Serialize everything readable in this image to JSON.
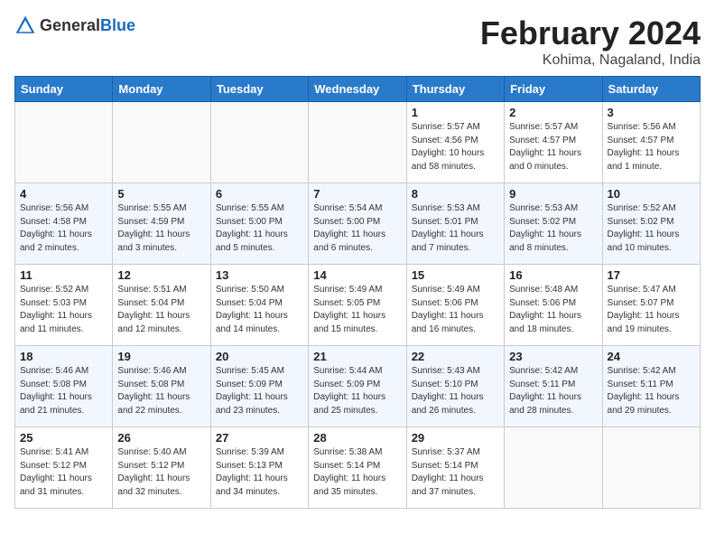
{
  "header": {
    "logo_general": "General",
    "logo_blue": "Blue",
    "month_title": "February 2024",
    "location": "Kohima, Nagaland, India"
  },
  "weekdays": [
    "Sunday",
    "Monday",
    "Tuesday",
    "Wednesday",
    "Thursday",
    "Friday",
    "Saturday"
  ],
  "weeks": [
    [
      {
        "day": "",
        "info": ""
      },
      {
        "day": "",
        "info": ""
      },
      {
        "day": "",
        "info": ""
      },
      {
        "day": "",
        "info": ""
      },
      {
        "day": "1",
        "info": "Sunrise: 5:57 AM\nSunset: 4:56 PM\nDaylight: 10 hours\nand 58 minutes."
      },
      {
        "day": "2",
        "info": "Sunrise: 5:57 AM\nSunset: 4:57 PM\nDaylight: 11 hours\nand 0 minutes."
      },
      {
        "day": "3",
        "info": "Sunrise: 5:56 AM\nSunset: 4:57 PM\nDaylight: 11 hours\nand 1 minute."
      }
    ],
    [
      {
        "day": "4",
        "info": "Sunrise: 5:56 AM\nSunset: 4:58 PM\nDaylight: 11 hours\nand 2 minutes."
      },
      {
        "day": "5",
        "info": "Sunrise: 5:55 AM\nSunset: 4:59 PM\nDaylight: 11 hours\nand 3 minutes."
      },
      {
        "day": "6",
        "info": "Sunrise: 5:55 AM\nSunset: 5:00 PM\nDaylight: 11 hours\nand 5 minutes."
      },
      {
        "day": "7",
        "info": "Sunrise: 5:54 AM\nSunset: 5:00 PM\nDaylight: 11 hours\nand 6 minutes."
      },
      {
        "day": "8",
        "info": "Sunrise: 5:53 AM\nSunset: 5:01 PM\nDaylight: 11 hours\nand 7 minutes."
      },
      {
        "day": "9",
        "info": "Sunrise: 5:53 AM\nSunset: 5:02 PM\nDaylight: 11 hours\nand 8 minutes."
      },
      {
        "day": "10",
        "info": "Sunrise: 5:52 AM\nSunset: 5:02 PM\nDaylight: 11 hours\nand 10 minutes."
      }
    ],
    [
      {
        "day": "11",
        "info": "Sunrise: 5:52 AM\nSunset: 5:03 PM\nDaylight: 11 hours\nand 11 minutes."
      },
      {
        "day": "12",
        "info": "Sunrise: 5:51 AM\nSunset: 5:04 PM\nDaylight: 11 hours\nand 12 minutes."
      },
      {
        "day": "13",
        "info": "Sunrise: 5:50 AM\nSunset: 5:04 PM\nDaylight: 11 hours\nand 14 minutes."
      },
      {
        "day": "14",
        "info": "Sunrise: 5:49 AM\nSunset: 5:05 PM\nDaylight: 11 hours\nand 15 minutes."
      },
      {
        "day": "15",
        "info": "Sunrise: 5:49 AM\nSunset: 5:06 PM\nDaylight: 11 hours\nand 16 minutes."
      },
      {
        "day": "16",
        "info": "Sunrise: 5:48 AM\nSunset: 5:06 PM\nDaylight: 11 hours\nand 18 minutes."
      },
      {
        "day": "17",
        "info": "Sunrise: 5:47 AM\nSunset: 5:07 PM\nDaylight: 11 hours\nand 19 minutes."
      }
    ],
    [
      {
        "day": "18",
        "info": "Sunrise: 5:46 AM\nSunset: 5:08 PM\nDaylight: 11 hours\nand 21 minutes."
      },
      {
        "day": "19",
        "info": "Sunrise: 5:46 AM\nSunset: 5:08 PM\nDaylight: 11 hours\nand 22 minutes."
      },
      {
        "day": "20",
        "info": "Sunrise: 5:45 AM\nSunset: 5:09 PM\nDaylight: 11 hours\nand 23 minutes."
      },
      {
        "day": "21",
        "info": "Sunrise: 5:44 AM\nSunset: 5:09 PM\nDaylight: 11 hours\nand 25 minutes."
      },
      {
        "day": "22",
        "info": "Sunrise: 5:43 AM\nSunset: 5:10 PM\nDaylight: 11 hours\nand 26 minutes."
      },
      {
        "day": "23",
        "info": "Sunrise: 5:42 AM\nSunset: 5:11 PM\nDaylight: 11 hours\nand 28 minutes."
      },
      {
        "day": "24",
        "info": "Sunrise: 5:42 AM\nSunset: 5:11 PM\nDaylight: 11 hours\nand 29 minutes."
      }
    ],
    [
      {
        "day": "25",
        "info": "Sunrise: 5:41 AM\nSunset: 5:12 PM\nDaylight: 11 hours\nand 31 minutes."
      },
      {
        "day": "26",
        "info": "Sunrise: 5:40 AM\nSunset: 5:12 PM\nDaylight: 11 hours\nand 32 minutes."
      },
      {
        "day": "27",
        "info": "Sunrise: 5:39 AM\nSunset: 5:13 PM\nDaylight: 11 hours\nand 34 minutes."
      },
      {
        "day": "28",
        "info": "Sunrise: 5:38 AM\nSunset: 5:14 PM\nDaylight: 11 hours\nand 35 minutes."
      },
      {
        "day": "29",
        "info": "Sunrise: 5:37 AM\nSunset: 5:14 PM\nDaylight: 11 hours\nand 37 minutes."
      },
      {
        "day": "",
        "info": ""
      },
      {
        "day": "",
        "info": ""
      }
    ]
  ]
}
